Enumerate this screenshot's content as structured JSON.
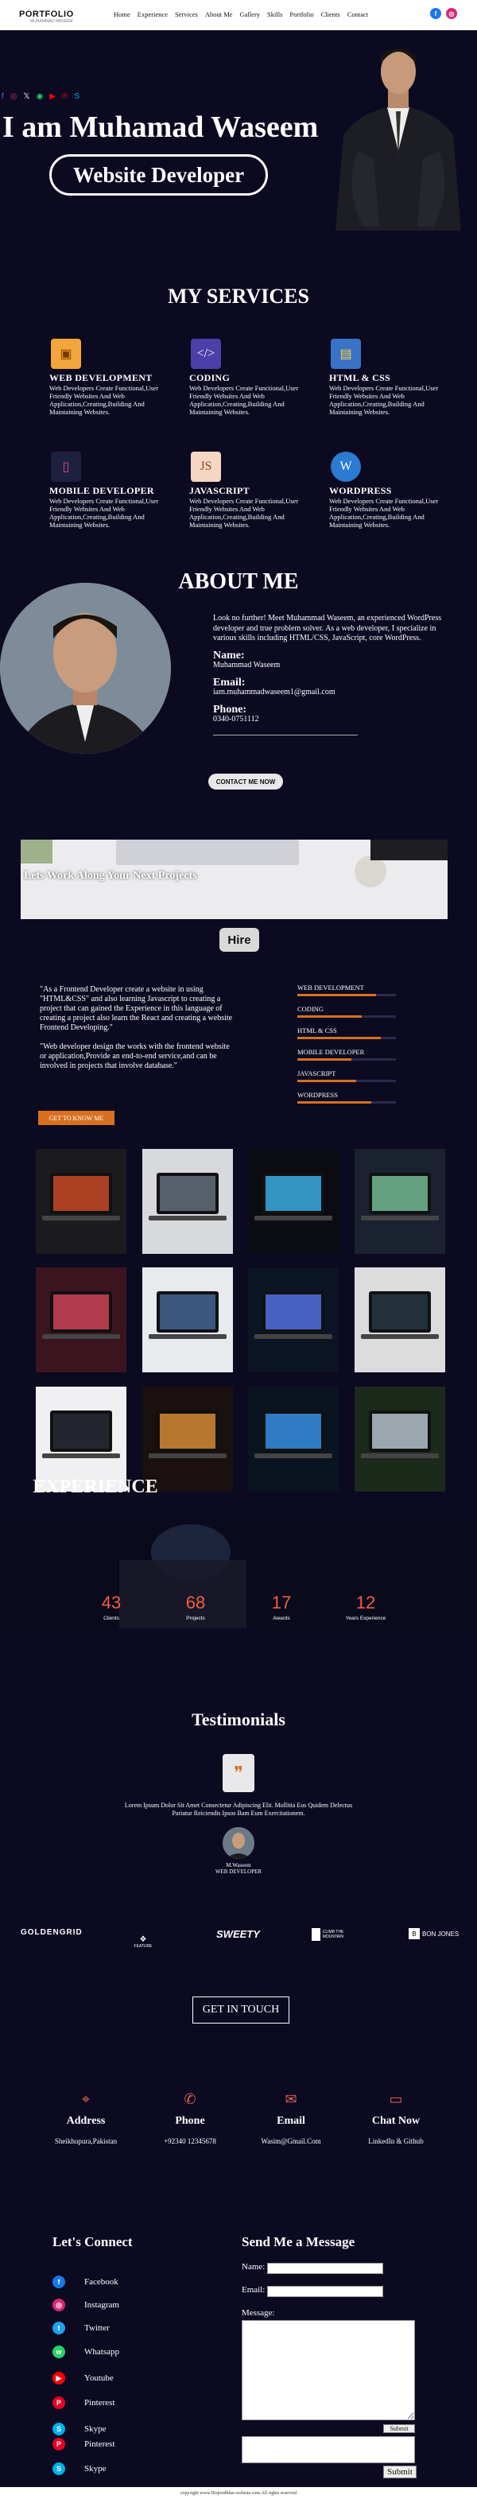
{
  "nav": {
    "logo": "PORTFOLIO",
    "logo_sub": "MUHAMMAD WASEEM",
    "items": [
      "Home",
      "Experience",
      "Services",
      "About Me",
      "Gallery",
      "Skills",
      "Portfolio",
      "Clients",
      "Contact"
    ]
  },
  "hero": {
    "social": [
      "f",
      "◎",
      "𝕏",
      "◉",
      "▶",
      "℗",
      "S"
    ],
    "title": "I am Muhamad Waseem",
    "button": "Website Developer"
  },
  "services": {
    "heading": "MY SERVICES",
    "items": [
      {
        "title": "WEB DEVELOPMENT",
        "text": "Web Developers Create Functional,User Friendly Websites And Web Application,Creating,Building And Maintaining Websites."
      },
      {
        "title": "CODING",
        "text": "Web Developers Create Functional,User Friendly Websites And Web Application,Creating,Building And Maintaining Websites."
      },
      {
        "title": "HTML & CSS",
        "text": "Web Developers Create Functional,User Friendly Websites And Web Application,Creating,Building And Maintaining Websites."
      },
      {
        "title": "MOBILE DEVELOPER",
        "text": "Web Developers Create Functional,User Friendly Websites And Web Application,Creating,Building And Maintaining Websites."
      },
      {
        "title": "JAVASCRIPT",
        "text": "Web Developers Create Functional,User Friendly Websites And Web Application,Creating,Building And Maintaining Websites."
      },
      {
        "title": "WORDPRESS",
        "text": "Web Developers Create Functional,User Friendly Websites And Web Application,Creating,Building And Maintaining Websites."
      }
    ]
  },
  "about": {
    "heading": "ABOUT ME",
    "text": "Look no further! Meet Muhammad Waseem, an experienced WordPress developer and true problem solver. As a web developer, I specialize in various skills including HTML/CSS, JavaScript, core WordPress.",
    "name_label": "Name:",
    "name": "Muhammad Waseem",
    "email_label": "Email:",
    "email": "iam.muhammadwaseem1@gmail.com",
    "phone_label": "Phone:",
    "phone": "0340-0751112",
    "button": "CONTACT ME NOW"
  },
  "banner": {
    "text": "Lets Work Along Your Next Projects",
    "hire": "Hire"
  },
  "quote": {
    "p1": "\"As a Frontend Developer create a website in using \"HTML&CSS\" and also learning Javascript to creating a project that can gained the Experience in this language of creating a project also learn the React and creating a website Frontend Developing.\"",
    "p2": "\"Web developer design the works with the frontend website or application,Provide an end-to-end service,and can be involved in projects that involve database.\"",
    "button": "GET TO KNOW ME"
  },
  "skills": [
    {
      "label": "WEB DEVELOPMENT",
      "level": 0.8
    },
    {
      "label": "CODING",
      "level": 0.65
    },
    {
      "label": "HTML & CSS",
      "level": 0.85
    },
    {
      "label": "MOBILE DEVELOPER",
      "level": 0.55
    },
    {
      "label": "JAVASCRIPT",
      "level": 0.6
    },
    {
      "label": "WORDPRESS",
      "level": 0.75
    }
  ],
  "experience": {
    "heading": "EXPERIENCE",
    "stats": [
      {
        "n": "43",
        "l": "Clients"
      },
      {
        "n": "68",
        "l": "Projects"
      },
      {
        "n": "17",
        "l": "Awards"
      },
      {
        "n": "12",
        "l": "Years Experience"
      }
    ]
  },
  "testimonials": {
    "heading": "Testimonials",
    "quote_mark": "❞",
    "text": "Lorem Ipsum Dolor Sit Amet Consectetur Adipiscing Elit. Mollitia Eos Quidem Delectus Pariatur Reiciendis Ipsos Bam Eum Exercitationem.",
    "name": "M.Waseem",
    "role": "WEB DEVELOPER"
  },
  "brands": [
    "GOLDENGRID",
    "FEATURE",
    "SWEETY",
    "CLIMB THE MOUNTAIN",
    "BON JONES"
  ],
  "get_in_touch": "GET IN TOUCH",
  "contact": [
    {
      "title": "Address",
      "value": "Sheikhupura,Pakistan"
    },
    {
      "title": "Phone",
      "value": "+92340 12345678"
    },
    {
      "title": "Email",
      "value": "Wasim@Gmail.Com"
    },
    {
      "title": "Chat Now",
      "value": "LinkedIn & Github"
    }
  ],
  "connect": {
    "heading": "Let's Connect",
    "items": [
      "Facebook",
      "Instagram",
      "Twitter",
      "Whatsapp",
      "Youtube",
      "Pinterest",
      "Skype",
      "Pinterest",
      "Skype"
    ]
  },
  "form": {
    "heading": "Send Me a Message",
    "name": "Name:",
    "email": "Email:",
    "message": "Message:",
    "submit": "Submit"
  },
  "footer": "copyright www.Hirpordblue-website.com.All rights reserved",
  "colors": {
    "bg": "#0b0a21",
    "accent": "#d8701f",
    "stat": "#f0603c"
  }
}
